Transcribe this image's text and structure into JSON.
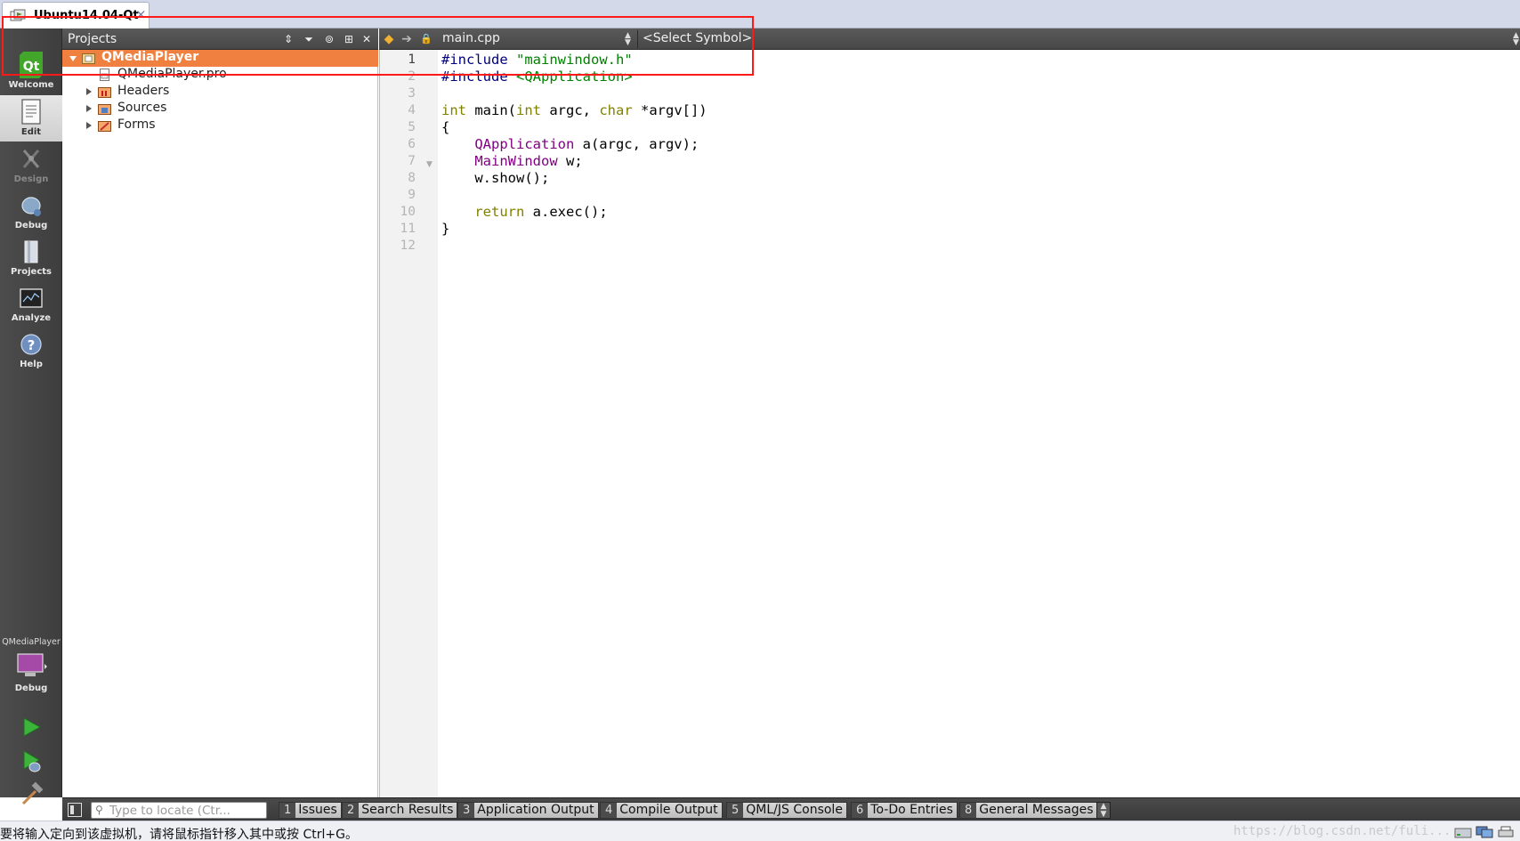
{
  "vm_tab": {
    "title": "Ubuntu14.04-Qt",
    "close": "×"
  },
  "modes": [
    {
      "label": "Welcome",
      "icon": "qt-logo-icon"
    },
    {
      "label": "Edit",
      "icon": "edit-document-icon"
    },
    {
      "label": "Design",
      "icon": "design-icon"
    },
    {
      "label": "Debug",
      "icon": "debug-bug-icon"
    },
    {
      "label": "Projects",
      "icon": "projects-icon"
    },
    {
      "label": "Analyze",
      "icon": "analyze-icon"
    },
    {
      "label": "Help",
      "icon": "help-icon"
    }
  ],
  "kit": {
    "project": "QMediaPlayer",
    "build": "Debug"
  },
  "projects_pane": {
    "title": "Projects",
    "tree": [
      {
        "label": "QMediaPlayer",
        "type": "project",
        "expanded": true,
        "selected": true
      },
      {
        "label": "QMediaPlayer.pro",
        "type": "pro-file"
      },
      {
        "label": "Headers",
        "type": "folder"
      },
      {
        "label": "Sources",
        "type": "folder"
      },
      {
        "label": "Forms",
        "type": "folder"
      }
    ]
  },
  "editor": {
    "file": "main.cpp",
    "symbol": "<Select Symbol>",
    "current_line": 1,
    "line_numbers": [
      "1",
      "2",
      "3",
      "4",
      "5",
      "6",
      "7",
      "8",
      "9",
      "10",
      "11",
      "12"
    ],
    "lines": [
      [
        {
          "t": "#include ",
          "c": "pp"
        },
        {
          "t": "\"mainwindow.h\"",
          "c": "str"
        }
      ],
      [
        {
          "t": "#include ",
          "c": "pp"
        },
        {
          "t": "<QApplication>",
          "c": "str"
        }
      ],
      [],
      [
        {
          "t": "int",
          "c": "kw"
        },
        {
          "t": " main(",
          "c": ""
        },
        {
          "t": "int",
          "c": "kw"
        },
        {
          "t": " argc, ",
          "c": ""
        },
        {
          "t": "char",
          "c": "kw"
        },
        {
          "t": " *argv[])",
          "c": ""
        }
      ],
      [
        {
          "t": "{",
          "c": ""
        }
      ],
      [
        {
          "t": "    ",
          "c": ""
        },
        {
          "t": "QApplication",
          "c": "type"
        },
        {
          "t": " a(argc, argv);",
          "c": ""
        }
      ],
      [
        {
          "t": "    ",
          "c": ""
        },
        {
          "t": "MainWindow",
          "c": "type"
        },
        {
          "t": " w;",
          "c": ""
        }
      ],
      [
        {
          "t": "    w.show();",
          "c": ""
        }
      ],
      [],
      [
        {
          "t": "    ",
          "c": ""
        },
        {
          "t": "return",
          "c": "kw"
        },
        {
          "t": " a.exec();",
          "c": ""
        }
      ],
      [
        {
          "t": "}",
          "c": ""
        }
      ],
      []
    ]
  },
  "output_bar": {
    "locator_placeholder": "Type to locate (Ctr...",
    "panes": [
      {
        "num": "1",
        "label": "Issues"
      },
      {
        "num": "2",
        "label": "Search Results"
      },
      {
        "num": "3",
        "label": "Application Output"
      },
      {
        "num": "4",
        "label": "Compile Output"
      },
      {
        "num": "5",
        "label": "QML/JS Console"
      },
      {
        "num": "6",
        "label": "To-Do Entries"
      },
      {
        "num": "8",
        "label": "General Messages"
      }
    ]
  },
  "status": {
    "text": "要将输入定向到该虚拟机，请将鼠标指针移入其中或按 Ctrl+G。",
    "watermark": "https://blog.csdn.net/fuli..."
  },
  "colors": {
    "selection": "#f08040",
    "annotation": "#ff1a1a",
    "preprocessor": "#000080",
    "string": "#008000",
    "keyword": "#808000",
    "type": "#800080"
  }
}
